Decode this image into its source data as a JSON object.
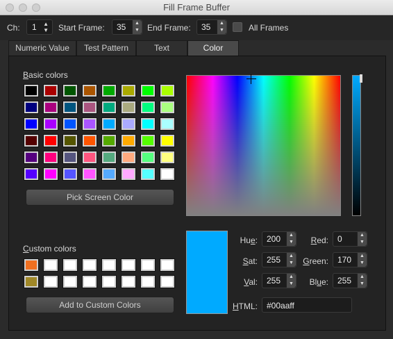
{
  "window": {
    "title": "Fill Frame Buffer"
  },
  "toolbar": {
    "ch_label": "Ch:",
    "ch_value": "1",
    "start_label": "Start Frame:",
    "start_value": "35",
    "end_label": "End Frame:",
    "end_value": "35",
    "all_frames_label": "All Frames",
    "all_frames_checked": false
  },
  "tabs": [
    {
      "label": "Numeric Value",
      "active": false
    },
    {
      "label": "Test Pattern",
      "active": false
    },
    {
      "label": "Text",
      "active": false
    },
    {
      "label": "Color",
      "active": true
    }
  ],
  "color_dialog": {
    "basic_colors_label": "Basic colors",
    "basic_colors": [
      [
        "#000000",
        "#aa0000",
        "#005500",
        "#aa5500",
        "#00aa00",
        "#aaaa00",
        "#00ff00",
        "#aaff00"
      ],
      [
        "#00007f",
        "#aa007f",
        "#00557f",
        "#aa557f",
        "#00aa7f",
        "#aaaa7f",
        "#00ff7f",
        "#aaff7f"
      ],
      [
        "#0000ff",
        "#aa00ff",
        "#0055ff",
        "#aa55ff",
        "#00aaff",
        "#aaaaff",
        "#00ffff",
        "#aaffff"
      ],
      [
        "#550000",
        "#ff0000",
        "#555500",
        "#ff5500",
        "#55aa00",
        "#ffaa00",
        "#55ff00",
        "#ffff00"
      ],
      [
        "#55007f",
        "#ff007f",
        "#55557f",
        "#ff557f",
        "#55aa7f",
        "#ffaa7f",
        "#55ff7f",
        "#ffff7f"
      ],
      [
        "#5500ff",
        "#ff00ff",
        "#5555ff",
        "#ff55ff",
        "#55aaff",
        "#ffaaff",
        "#55ffff",
        "#ffffff"
      ]
    ],
    "pick_screen_label": "Pick Screen Color",
    "custom_colors_label": "Custom colors",
    "custom_colors": [
      [
        "#f07020",
        "#ffffff",
        "#ffffff",
        "#ffffff",
        "#ffffff",
        "#ffffff",
        "#ffffff",
        "#ffffff"
      ],
      [
        "#a08828",
        "#ffffff",
        "#ffffff",
        "#ffffff",
        "#ffffff",
        "#ffffff",
        "#ffffff",
        "#ffffff"
      ]
    ],
    "add_custom_label": "Add to Custom Colors",
    "current_color": "#00aaff",
    "hue_label": "Hue:",
    "hue": "200",
    "sat_label": "Sat:",
    "sat": "255",
    "val_label": "Val:",
    "val": "255",
    "red_label": "Red:",
    "red": "0",
    "green_label": "Green:",
    "green": "170",
    "blue_label": "Blue:",
    "blue": "255",
    "html_label": "HTML:",
    "html": "#00aaff"
  }
}
